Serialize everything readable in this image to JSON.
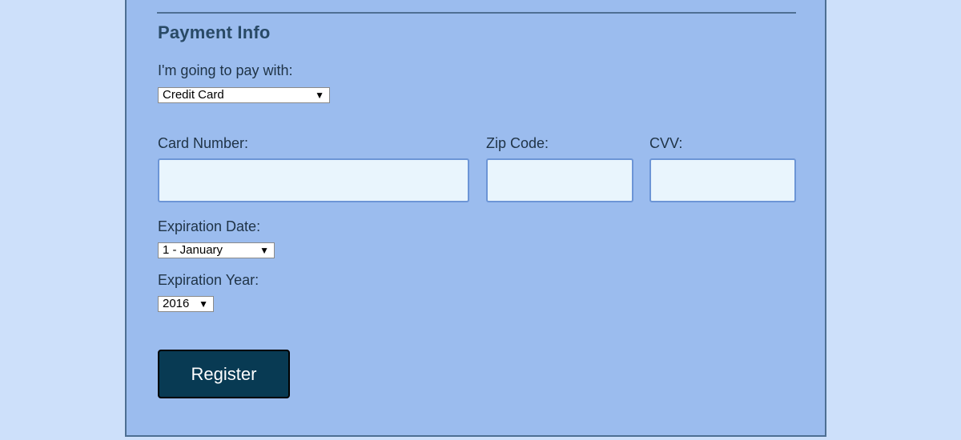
{
  "payment": {
    "section_title": "Payment Info",
    "pay_with_label": "I'm going to pay with:",
    "pay_with_value": "Credit Card",
    "card_number_label": "Card Number:",
    "card_number_value": "",
    "zip_label": "Zip Code:",
    "zip_value": "",
    "cvv_label": "CVV:",
    "cvv_value": "",
    "exp_date_label": "Expiration Date:",
    "exp_date_value": "1 - January",
    "exp_year_label": "Expiration Year:",
    "exp_year_value": "2016",
    "register_label": "Register"
  },
  "icons": {
    "dropdown": "chevron-down-icon"
  },
  "colors": {
    "page_background": "#cde0fa",
    "panel_background": "#9bbcee",
    "input_background": "#e9f5fd",
    "button_background": "#083a53",
    "title_color": "#294a66"
  }
}
